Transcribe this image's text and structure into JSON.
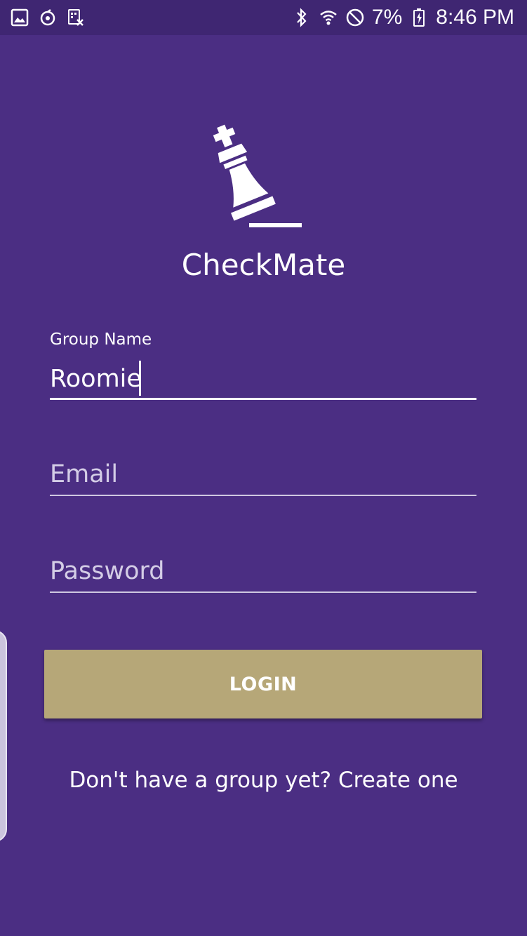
{
  "status_bar": {
    "left_icons": [
      "gallery-icon",
      "sync-icon",
      "screenshot-icon"
    ],
    "right_icons": [
      "bluetooth-icon",
      "wifi-icon",
      "do-not-disturb-icon",
      "battery-icon"
    ],
    "battery": "7%",
    "time": "8:46 PM"
  },
  "app": {
    "title": "CheckMate",
    "logo_icon": "chess-king-icon"
  },
  "form": {
    "group_name": {
      "label": "Group Name",
      "value": "Roomie",
      "placeholder": "Group Name"
    },
    "email": {
      "value": "",
      "placeholder": "Email"
    },
    "password": {
      "value": "",
      "placeholder": "Password"
    },
    "login_label": "LOGIN"
  },
  "signup": {
    "text": "Don't have a group yet? Create one"
  },
  "colors": {
    "background": "#4b2e83",
    "status_bar": "#3f2672",
    "button": "#b6a778",
    "text": "#ffffff"
  }
}
